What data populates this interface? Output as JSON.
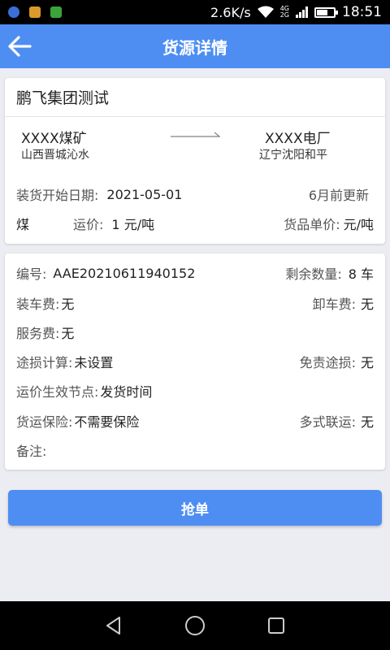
{
  "statusbar": {
    "speed": "2.6K/s",
    "net_top": "4G",
    "net_bottom": "2G",
    "time": "18:51",
    "battery_level": 0.6,
    "app_colors": [
      "#3a6fd8",
      "#d89a2a",
      "#3aa43a"
    ]
  },
  "header": {
    "title": "货源详情",
    "accent": "#4e8ef3"
  },
  "cargo": {
    "company": "鹏飞集团测试",
    "from_name": "XXXX煤矿",
    "from_place": "山西晋城沁水",
    "to_name": "XXXX电厂",
    "to_place": "辽宁沈阳和平",
    "load_date_label": "装货开始日期:",
    "load_date": "2021-05-01",
    "updated": "6月前更新",
    "goods": "煤",
    "freight_label": "运价:",
    "freight": "1 元/吨",
    "unit_price_label": "货品单价:",
    "unit_price": "元/吨"
  },
  "details": {
    "number_label": "编号:",
    "number": "AAE20210611940152",
    "remaining_label": "剩余数量:",
    "remaining": "8 车",
    "loading_fee_label": "装车费:",
    "loading_fee": "无",
    "unloading_fee_label": "卸车费:",
    "unloading_fee": "无",
    "service_fee_label": "服务费:",
    "service_fee": "无",
    "loss_calc_label": "途损计算:",
    "loss_calc": "未设置",
    "loss_exempt_label": "免责途损:",
    "loss_exempt": "无",
    "effective_label": "运价生效节点:",
    "effective": "发货时间",
    "insurance_label": "货运保险:",
    "insurance": "不需要保险",
    "multimodal_label": "多式联运:",
    "multimodal": "无",
    "remark_label": "备注:"
  },
  "actions": {
    "grab_label": "抢单"
  }
}
